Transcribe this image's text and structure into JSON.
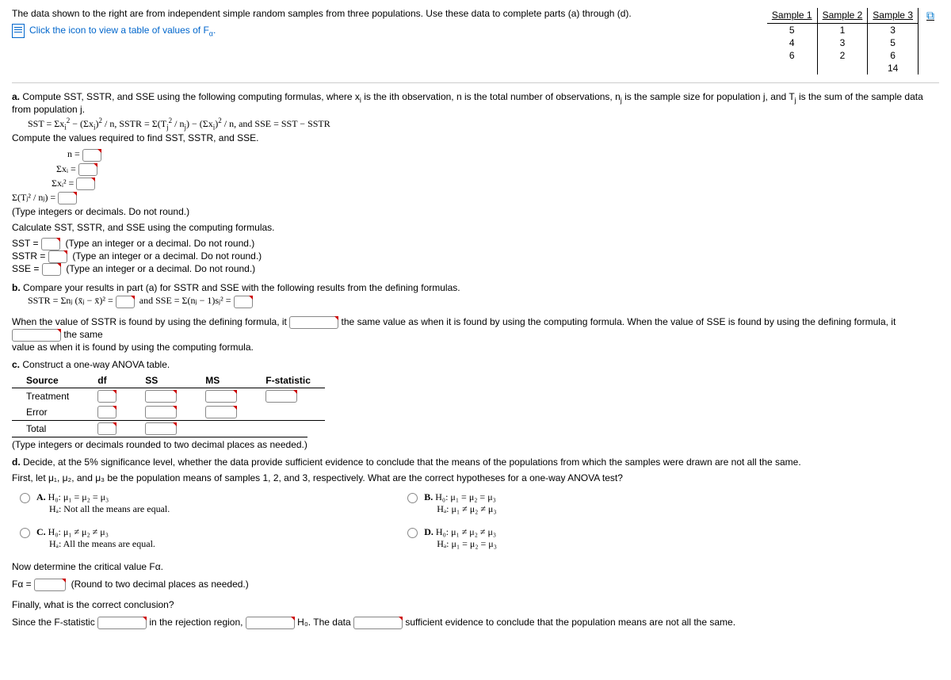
{
  "intro": "The data shown to the right are from independent simple random samples from three populations. Use these data to complete parts (a) through (d).",
  "link_text": "Click the icon to view a table of values of F",
  "link_sub": "α",
  "table": {
    "headers": [
      "Sample 1",
      "Sample 2",
      "Sample 3"
    ],
    "rows": [
      [
        "5",
        "1",
        "3"
      ],
      [
        "4",
        "3",
        "5"
      ],
      [
        "6",
        "2",
        "6"
      ],
      [
        "",
        "",
        "14"
      ]
    ]
  },
  "a": {
    "intro": "a. Compute SST, SSTR, and SSE using the following computing formulas, where xᵢ is the ith observation, n is the total number of observations, nⱼ is the sample size for population j, and Tⱼ is the sum of the sample data from population j.",
    "formula": "SST = Σxᵢ² − (Σxᵢ)² / n, SSTR = Σ(Tⱼ² / nⱼ) − (Σxᵢ)² / n, and SSE = SST − SSTR",
    "compute_label": "Compute the values required to find SST, SSTR, and SSE.",
    "lines": [
      "n =",
      "Σxᵢ =",
      "Σxᵢ² =",
      "Σ(Tⱼ² / nⱼ) ="
    ],
    "helper1": "(Type integers or decimals. Do not round.)",
    "calc_label": "Calculate SST, SSTR, and SSE using the computing formulas.",
    "sst": "SST =",
    "sstr": "SSTR =",
    "sse": "SSE =",
    "helper2": "(Type an integer or a decimal. Do not round.)"
  },
  "b": {
    "intro": "b. Compare your results in part (a) for SSTR and SSE with the following results from the defining formulas.",
    "formula_left": "SSTR = Σnⱼ (x̄ⱼ − x̄)² =",
    "formula_right": "and SSE = Σ(nⱼ − 1)sⱼ² =",
    "sent1a": "When the value of SSTR is found by using the defining formula, it",
    "sent1b": "the same value as when it is found by using the computing formula. When the value of SSE is found by using the defining formula, it",
    "sent1c": "the same",
    "sent2": "value as when it is found by using the computing formula."
  },
  "c": {
    "intro": "c. Construct a one-way ANOVA table.",
    "headers": [
      "Source",
      "df",
      "SS",
      "MS",
      "F-statistic"
    ],
    "rows": [
      "Treatment",
      "Error",
      "Total"
    ],
    "helper": "(Type integers or decimals rounded to two decimal places as needed.)"
  },
  "d": {
    "intro": "d. Decide, at the 5% significance level, whether the data provide sufficient evidence to conclude that the means of the populations from which the samples were drawn are not all the same.",
    "first": "First, let μ₁, μ₂, and μ₃ be the population means of samples 1, 2, and 3, respectively. What are the correct hypotheses for a one-way ANOVA test?",
    "optA": {
      "tag": "A.",
      "h0": "H₀: μ₁ = μ₂ = μ₃",
      "ha": "Hₐ: Not all the means are equal."
    },
    "optB": {
      "tag": "B.",
      "h0": "H₀: μ₁ = μ₂ = μ₃",
      "ha": "Hₐ: μ₁ ≠ μ₂ ≠ μ₃"
    },
    "optC": {
      "tag": "C.",
      "h0": "H₀: μ₁ ≠ μ₂ ≠ μ₃",
      "ha": "Hₐ: All the means are equal."
    },
    "optD": {
      "tag": "D.",
      "h0": "H₀: μ₁ ≠ μ₂ ≠ μ₃",
      "ha": "Hₐ: μ₁ = μ₂ = μ₃"
    },
    "crit_label": "Now determine the critical value Fα.",
    "fa": "Fα =",
    "fa_helper": "(Round to two decimal places as needed.)",
    "final_q": "Finally, what is the correct conclusion?",
    "conc1": "Since the F-statistic",
    "conc2": "in the rejection region,",
    "conc3": "H₀. The data",
    "conc4": "sufficient evidence to conclude that the population means are not all the same."
  }
}
